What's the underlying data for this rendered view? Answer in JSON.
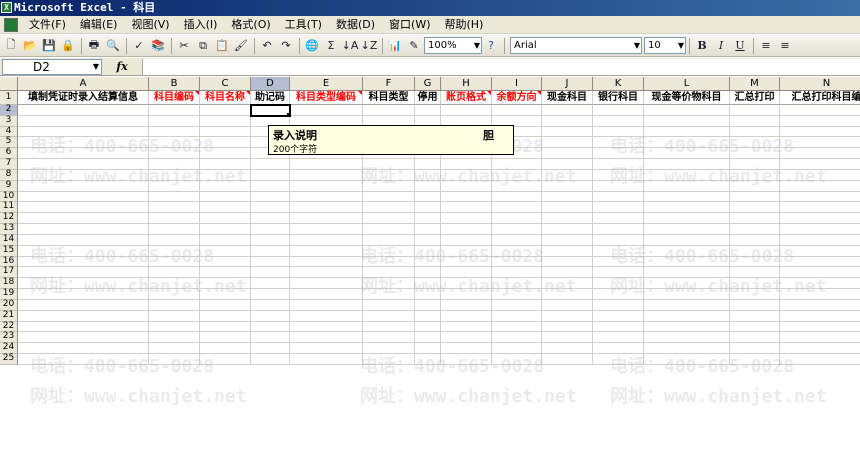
{
  "window": {
    "title": "Microsoft Excel - 科目"
  },
  "menu": [
    "文件(F)",
    "编辑(E)",
    "视图(V)",
    "插入(I)",
    "格式(O)",
    "工具(T)",
    "数据(D)",
    "窗口(W)",
    "帮助(H)"
  ],
  "toolbar": {
    "zoom": "100%",
    "font_name": "Arial",
    "font_size": "10",
    "bold": "B",
    "italic": "I",
    "underline": "U",
    "sum": "Σ"
  },
  "formula_bar": {
    "name_box": "D2",
    "fx": "fx",
    "formula": ""
  },
  "columns": [
    "A",
    "B",
    "C",
    "D",
    "E",
    "F",
    "G",
    "H",
    "I",
    "J",
    "K",
    "L",
    "M",
    "N"
  ],
  "rows": [
    "1",
    "2",
    "3",
    "4",
    "5",
    "6",
    "7",
    "8",
    "9",
    "10",
    "11",
    "12",
    "13",
    "14",
    "15",
    "16",
    "17",
    "18",
    "19",
    "20",
    "21",
    "22",
    "23",
    "24",
    "25"
  ],
  "selection": {
    "column": "D",
    "row": "2"
  },
  "headers": [
    {
      "col": "A",
      "text": "填制凭证时录入结算信息",
      "color": "#000000"
    },
    {
      "col": "B",
      "text": "科目编码",
      "color": "#ff0000"
    },
    {
      "col": "C",
      "text": "科目名称",
      "color": "#ff0000"
    },
    {
      "col": "D",
      "text": "助记码",
      "color": "#000000"
    },
    {
      "col": "E",
      "text": "科目类型编码",
      "color": "#ff0000"
    },
    {
      "col": "F",
      "text": "科目类型",
      "color": "#000000"
    },
    {
      "col": "G",
      "text": "停用",
      "color": "#000000"
    },
    {
      "col": "H",
      "text": "账页格式",
      "color": "#ff0000"
    },
    {
      "col": "I",
      "text": "余额方向",
      "color": "#ff0000"
    },
    {
      "col": "J",
      "text": "现金科目",
      "color": "#000000"
    },
    {
      "col": "K",
      "text": "银行科目",
      "color": "#000000"
    },
    {
      "col": "L",
      "text": "现金等价物科目",
      "color": "#000000"
    },
    {
      "col": "M",
      "text": "汇总打印",
      "color": "#000000"
    },
    {
      "col": "N",
      "text": "汇总打印科目编",
      "color": "#000000"
    }
  ],
  "tooltip": {
    "title": "录入说明",
    "body": "200个字符",
    "extra": "胆"
  },
  "watermarks": [
    "电话：400-665-0028",
    "网址：www.chanjet.net"
  ]
}
